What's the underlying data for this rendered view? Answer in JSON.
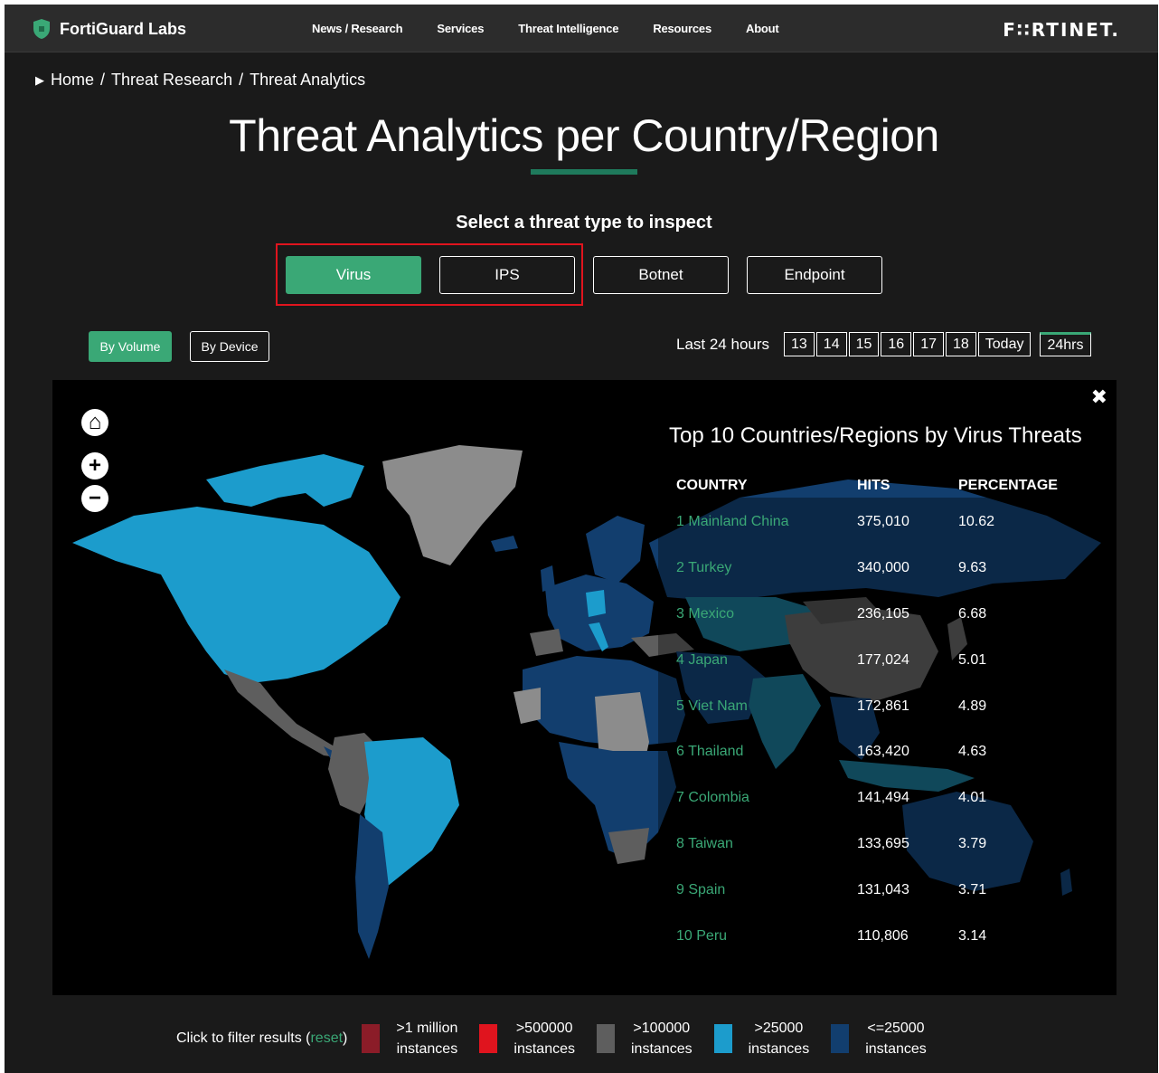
{
  "nav": {
    "brand": "FortiGuard Labs",
    "links": [
      "News / Research",
      "Services",
      "Threat Intelligence",
      "Resources",
      "About"
    ],
    "logo": "F∷RTINET."
  },
  "breadcrumb": {
    "items": [
      "Home",
      "Threat Research",
      "Threat Analytics"
    ],
    "separator": "/"
  },
  "page": {
    "title": "Threat Analytics per Country/Region",
    "subtitle": "Select a threat type to inspect"
  },
  "threat_types": {
    "selected": "Virus",
    "items": [
      "Virus",
      "IPS",
      "Botnet",
      "Endpoint"
    ]
  },
  "view": {
    "by_volume": "By Volume",
    "by_device": "By Device",
    "selected": "By Volume"
  },
  "time": {
    "label": "Last 24 hours",
    "days": [
      "13",
      "14",
      "15",
      "16",
      "17",
      "18",
      "Today"
    ],
    "range": "24hrs",
    "selected": "24hrs"
  },
  "map": {
    "close": "✖",
    "controls": {
      "home": "⌂",
      "zoom_in": "+",
      "zoom_out": "−"
    },
    "table_title": "Top 10 Countries/Regions by Virus Threats",
    "columns": [
      "COUNTRY",
      "HITS",
      "PERCENTAGE"
    ],
    "rows": [
      {
        "rank": "1",
        "country": "Mainland China",
        "hits": "375,010",
        "pct": "10.62"
      },
      {
        "rank": "2",
        "country": "Turkey",
        "hits": "340,000",
        "pct": "9.63"
      },
      {
        "rank": "3",
        "country": "Mexico",
        "hits": "236,105",
        "pct": "6.68"
      },
      {
        "rank": "4",
        "country": "Japan",
        "hits": "177,024",
        "pct": "5.01"
      },
      {
        "rank": "5",
        "country": "Viet Nam",
        "hits": "172,861",
        "pct": "4.89"
      },
      {
        "rank": "6",
        "country": "Thailand",
        "hits": "163,420",
        "pct": "4.63"
      },
      {
        "rank": "7",
        "country": "Colombia",
        "hits": "141,494",
        "pct": "4.01"
      },
      {
        "rank": "8",
        "country": "Taiwan",
        "hits": "133,695",
        "pct": "3.79"
      },
      {
        "rank": "9",
        "country": "Spain",
        "hits": "131,043",
        "pct": "3.71"
      },
      {
        "rank": "10",
        "country": "Peru",
        "hits": "110,806",
        "pct": "3.14"
      }
    ]
  },
  "legend": {
    "label_prefix": "Click to filter results (",
    "reset": "reset",
    "label_suffix": ")",
    "items": [
      {
        "line1": ">1 million",
        "line2": "instances",
        "color": "#8b1c28"
      },
      {
        "line1": ">500000",
        "line2": "instances",
        "color": "#e0141e"
      },
      {
        "line1": ">100000",
        "line2": "instances",
        "color": "#5e5e5e"
      },
      {
        "line1": ">25000",
        "line2": "instances",
        "color": "#1c9ccc"
      },
      {
        "line1": "<=25000",
        "line2": "instances",
        "color": "#123e6e"
      }
    ]
  },
  "colors": {
    "accent": "#3aa876",
    "highlight_box": "#e0141e",
    "background": "#1a1a1a",
    "map_background": "#000000"
  }
}
